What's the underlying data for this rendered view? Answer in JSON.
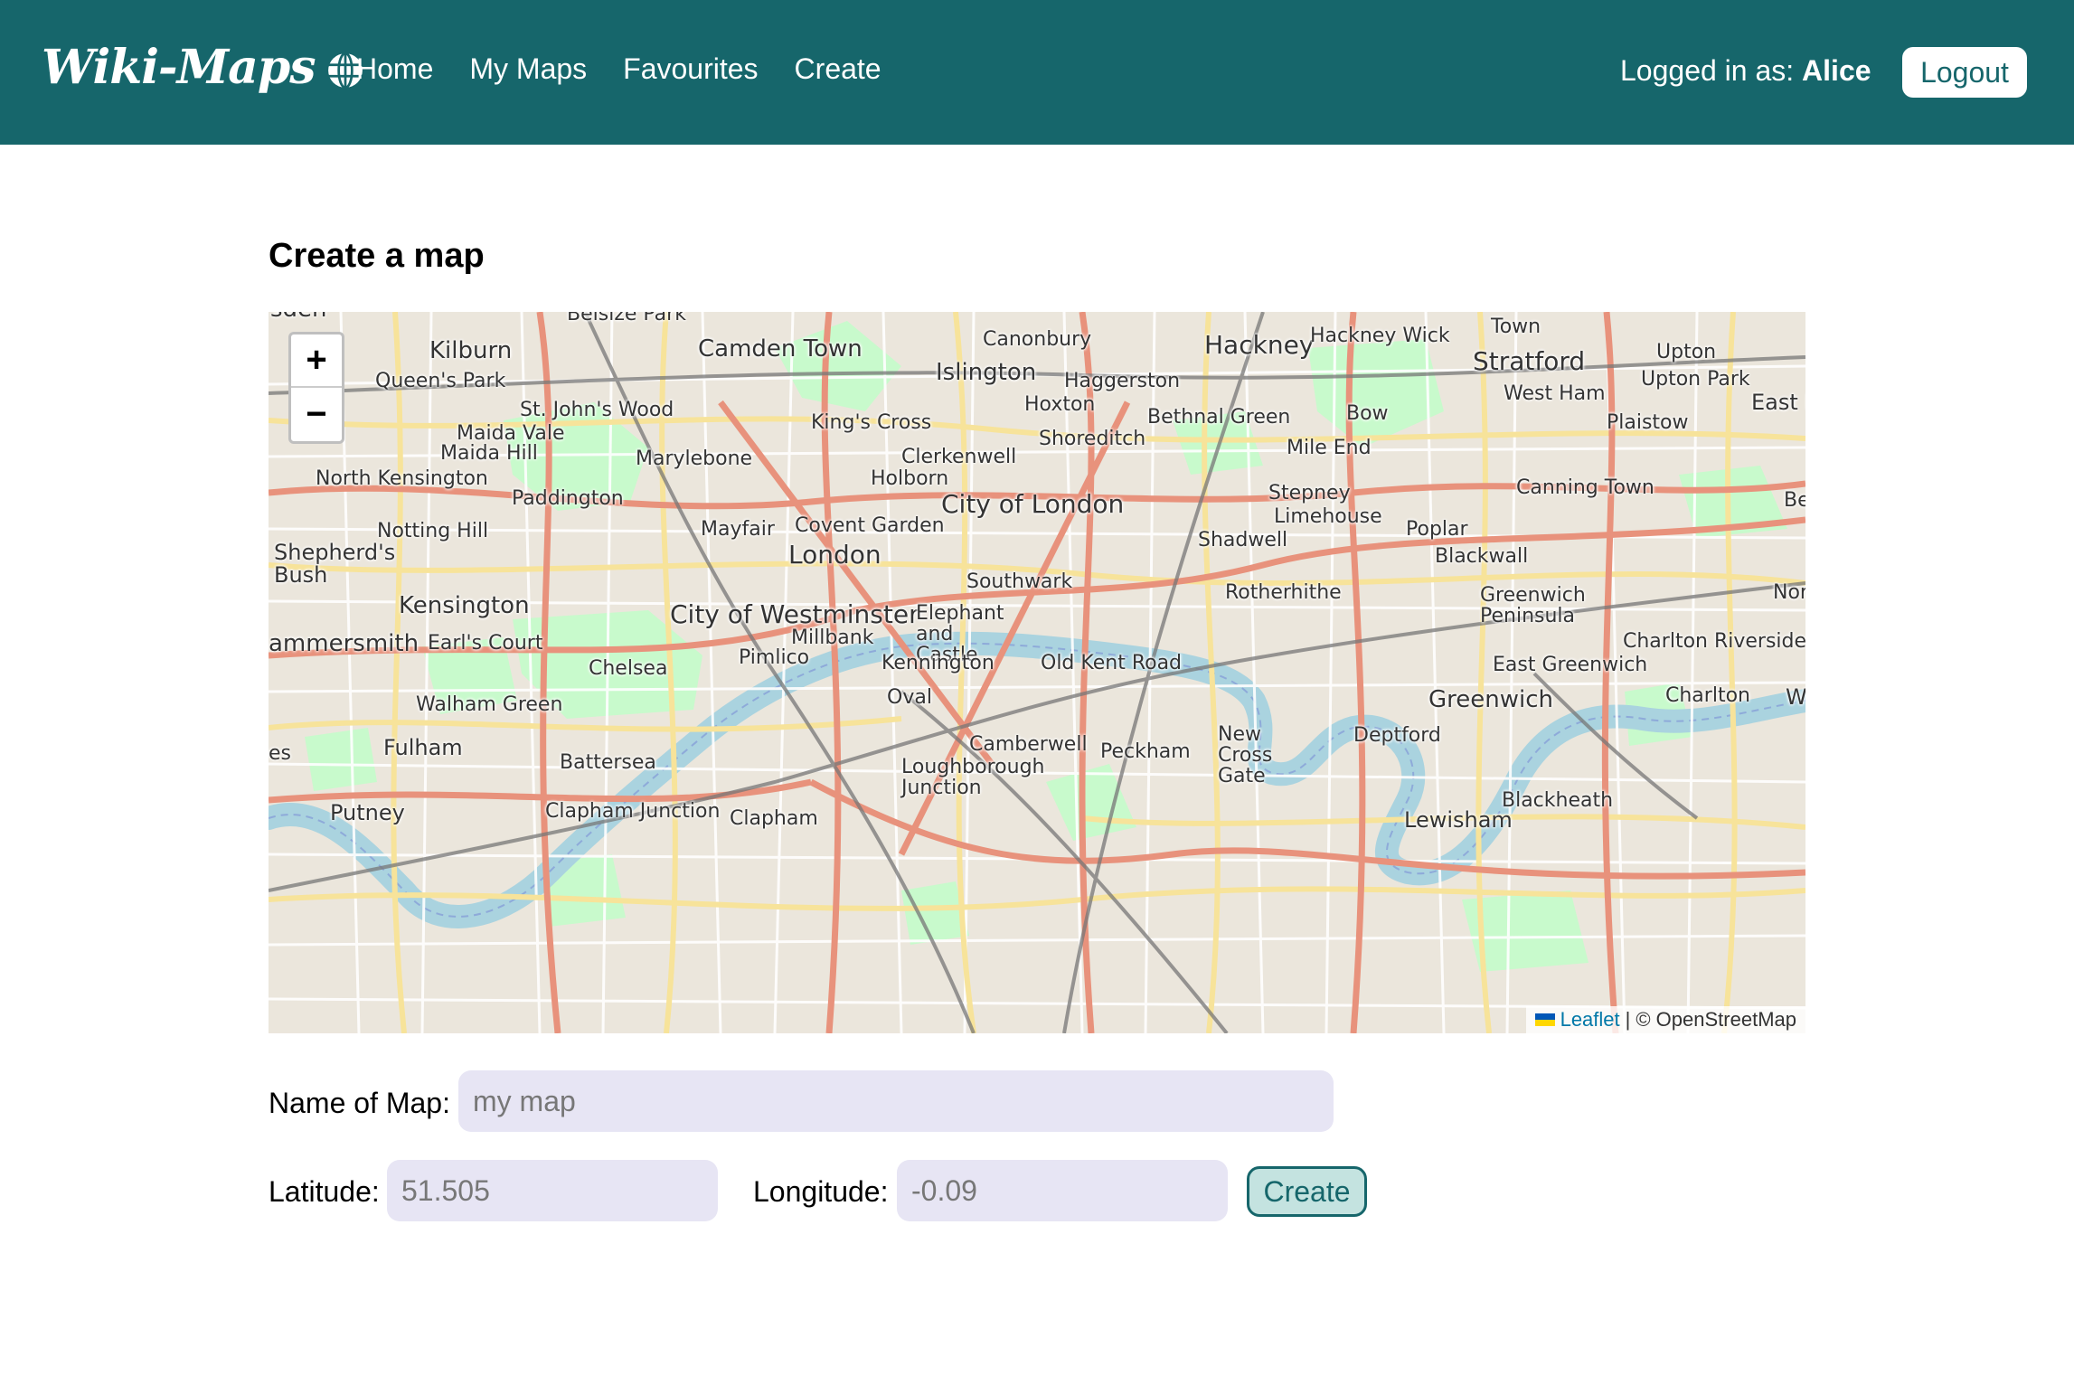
{
  "navbar": {
    "brand": "Wiki-Maps",
    "links": [
      "Home",
      "My Maps",
      "Favourites",
      "Create"
    ],
    "user_prefix": "Logged in as:",
    "user_name": "Alice",
    "logout_label": "Logout"
  },
  "main": {
    "title": "Create a map"
  },
  "map": {
    "zoom_in": "+",
    "zoom_out": "−",
    "attribution_link": "Leaflet",
    "attribution_separator": "|",
    "attribution_text": "© OpenStreetMap",
    "labels": [
      "sden",
      "Belsize Park",
      "Kilburn",
      "Camden Town",
      "Canonbury",
      "Hackney",
      "Hackney Wick",
      "Town",
      "Stratford",
      "Upton",
      "Queen's Park",
      "Islington",
      "Haggerston",
      "Upton Park",
      "St. John's Wood",
      "Hoxton",
      "West Ham",
      "East I",
      "Maida Vale",
      "King's Cross",
      "Bethnal Green",
      "Bow",
      "Plaistow",
      "Maida Hill",
      "Marylebone",
      "Clerkenwell",
      "Shoreditch",
      "Mile End",
      "North Kensington",
      "Holborn",
      "Paddington",
      "City of London",
      "Stepney",
      "Canning Town",
      "Be",
      "Notting Hill",
      "Mayfair",
      "Covent Garden",
      "Limehouse",
      "Poplar",
      "Shepherd's Bush",
      "London",
      "Shadwell",
      "Blackwall",
      "Southwark",
      "Kensington",
      "Rotherhithe",
      "Greenwich Peninsula",
      "Nor",
      "City of Westminster",
      "Elephant and Castle",
      "ammersmith",
      "Earl's Court",
      "Millbank",
      "Charlton Riverside",
      "Pimlico",
      "Chelsea",
      "Kennington",
      "Old Kent Road",
      "East Greenwich",
      "Oval",
      "Greenwich",
      "Charlton",
      "W",
      "Walham Green",
      "Fulham",
      "New Cross Gate",
      "Deptford",
      "Camberwell",
      "Peckham",
      "Battersea",
      "Loughborough Junction",
      "es",
      "Putney",
      "Clapham Junction",
      "Clapham",
      "Blackheath",
      "Lewisham"
    ]
  },
  "form": {
    "name_label": "Name of Map:",
    "name_placeholder": "my map",
    "lat_label": "Latitude:",
    "lat_placeholder": "51.505",
    "lng_label": "Longitude:",
    "lng_placeholder": "-0.09",
    "create_label": "Create"
  },
  "colors": {
    "navbar_bg": "#16666b",
    "input_bg": "#e7e5f4",
    "button_bg": "#c4e3e0",
    "river": "#aad3df",
    "park": "#c8facc"
  }
}
